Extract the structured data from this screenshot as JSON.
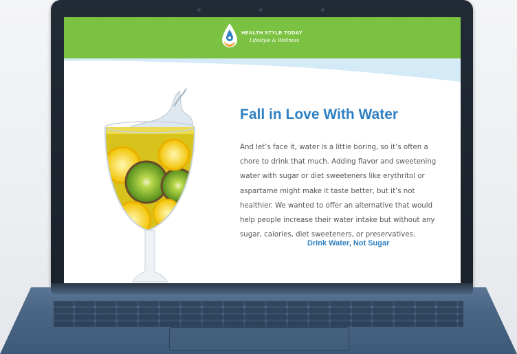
{
  "brand": {
    "name": "HEALTH STYLE TODAY",
    "tagline": "Lifestyle & Wellness"
  },
  "hero": {
    "headline": "Fall in Love With Water",
    "body": "And let’s face it, water is a little boring, so it’s often a chore to drink that much. Adding flavor and sweetening water with sugar or diet sweeteners like erythritol or aspartame might make it taste better, but it’s not healthier. We wanted to offer an alternative that would help people increase their water intake but without any sugar, calories, diet sweeteners, or preservatives.",
    "cta": "Drink Water, Not Sugar",
    "image": "fruit-infused-water-glass"
  },
  "colors": {
    "header_green": "#7cc242",
    "headline_blue": "#2f80c2",
    "body_text": "#555555",
    "laptop_base": "#4a6684",
    "bezel": "#1f2631"
  }
}
